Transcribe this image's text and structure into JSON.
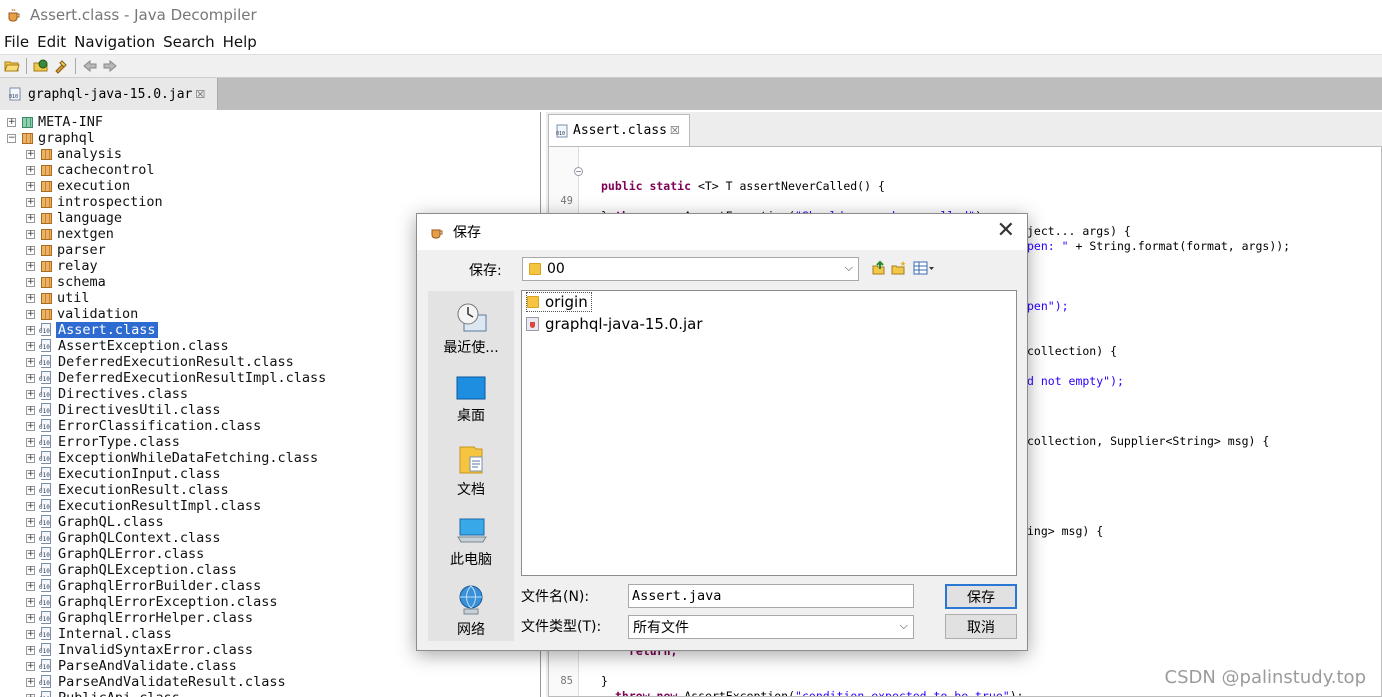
{
  "window": {
    "title": "Assert.class - Java Decompiler"
  },
  "menu": [
    "File",
    "Edit",
    "Navigation",
    "Search",
    "Help"
  ],
  "jar_tab": {
    "label": "graphql-java-15.0.jar",
    "close": "☒"
  },
  "tree": [
    {
      "label": "META-INF",
      "kind": "meta",
      "indent": 0,
      "exp": "+"
    },
    {
      "label": "graphql",
      "kind": "pkg",
      "indent": 0,
      "exp": "−"
    },
    {
      "label": "analysis",
      "kind": "pkg",
      "indent": 1,
      "exp": "+"
    },
    {
      "label": "cachecontrol",
      "kind": "pkg",
      "indent": 1,
      "exp": "+"
    },
    {
      "label": "execution",
      "kind": "pkg",
      "indent": 1,
      "exp": "+"
    },
    {
      "label": "introspection",
      "kind": "pkg",
      "indent": 1,
      "exp": "+"
    },
    {
      "label": "language",
      "kind": "pkg",
      "indent": 1,
      "exp": "+"
    },
    {
      "label": "nextgen",
      "kind": "pkg",
      "indent": 1,
      "exp": "+"
    },
    {
      "label": "parser",
      "kind": "pkg",
      "indent": 1,
      "exp": "+"
    },
    {
      "label": "relay",
      "kind": "pkg",
      "indent": 1,
      "exp": "+"
    },
    {
      "label": "schema",
      "kind": "pkg",
      "indent": 1,
      "exp": "+"
    },
    {
      "label": "util",
      "kind": "pkg",
      "indent": 1,
      "exp": "+"
    },
    {
      "label": "validation",
      "kind": "pkg",
      "indent": 1,
      "exp": "+"
    },
    {
      "label": "Assert.class",
      "kind": "cls",
      "indent": 1,
      "exp": "+",
      "selected": true
    },
    {
      "label": "AssertException.class",
      "kind": "cls",
      "indent": 1,
      "exp": "+"
    },
    {
      "label": "DeferredExecutionResult.class",
      "kind": "cls",
      "indent": 1,
      "exp": "+"
    },
    {
      "label": "DeferredExecutionResultImpl.class",
      "kind": "cls",
      "indent": 1,
      "exp": "+"
    },
    {
      "label": "Directives.class",
      "kind": "cls",
      "indent": 1,
      "exp": "+"
    },
    {
      "label": "DirectivesUtil.class",
      "kind": "cls",
      "indent": 1,
      "exp": "+"
    },
    {
      "label": "ErrorClassification.class",
      "kind": "cls",
      "indent": 1,
      "exp": "+"
    },
    {
      "label": "ErrorType.class",
      "kind": "cls",
      "indent": 1,
      "exp": "+"
    },
    {
      "label": "ExceptionWhileDataFetching.class",
      "kind": "cls",
      "indent": 1,
      "exp": "+"
    },
    {
      "label": "ExecutionInput.class",
      "kind": "cls",
      "indent": 1,
      "exp": "+"
    },
    {
      "label": "ExecutionResult.class",
      "kind": "cls",
      "indent": 1,
      "exp": "+"
    },
    {
      "label": "ExecutionResultImpl.class",
      "kind": "cls",
      "indent": 1,
      "exp": "+"
    },
    {
      "label": "GraphQL.class",
      "kind": "cls",
      "indent": 1,
      "exp": "+"
    },
    {
      "label": "GraphQLContext.class",
      "kind": "cls",
      "indent": 1,
      "exp": "+"
    },
    {
      "label": "GraphQLError.class",
      "kind": "cls",
      "indent": 1,
      "exp": "+"
    },
    {
      "label": "GraphQLException.class",
      "kind": "cls",
      "indent": 1,
      "exp": "+"
    },
    {
      "label": "GraphqlErrorBuilder.class",
      "kind": "cls",
      "indent": 1,
      "exp": "+"
    },
    {
      "label": "GraphqlErrorException.class",
      "kind": "cls",
      "indent": 1,
      "exp": "+"
    },
    {
      "label": "GraphqlErrorHelper.class",
      "kind": "cls",
      "indent": 1,
      "exp": "+"
    },
    {
      "label": "Internal.class",
      "kind": "cls",
      "indent": 1,
      "exp": "+"
    },
    {
      "label": "InvalidSyntaxError.class",
      "kind": "cls",
      "indent": 1,
      "exp": "+"
    },
    {
      "label": "ParseAndValidate.class",
      "kind": "cls",
      "indent": 1,
      "exp": "+"
    },
    {
      "label": "ParseAndValidateResult.class",
      "kind": "cls",
      "indent": 1,
      "exp": "+"
    },
    {
      "label": "PublicApi.class",
      "kind": "cls",
      "indent": 1,
      "exp": "+"
    }
  ],
  "code_tab": {
    "label": "Assert.class",
    "close": "☒"
  },
  "code": {
    "l1a": "public static",
    "l1b": " <T> T assertNeverCalled() {",
    "l2a": "throw new ",
    "l2b": "AssertException",
    "l2c": "(",
    "l2d": "\"Should never been called\"",
    "l2e": ");",
    "l3": "}",
    "frag1": "ject... args) {",
    "frag2a": "pen: \"",
    "frag2b": " + String.format(format, args));",
    "frag3": "pen\");",
    "frag4": "collection) {",
    "frag5": "d not empty\");",
    "frag6": "collection, Supplier<String> msg) {",
    "frag7": "ing> msg) {",
    "ret": "return;",
    "l85a": "throw new ",
    "l85b": "AssertException",
    "l85c": "(",
    "l85d": "\"condition expected to be true\"",
    "l85e": ");",
    "lend": "}",
    "ln49": "49",
    "ln85": "85",
    "fold": "−"
  },
  "dialog": {
    "title": "保存",
    "close": "✕",
    "save_in_label": "保存:",
    "save_in_value": "00",
    "places": [
      "最近使...",
      "桌面",
      "文档",
      "此电脑",
      "网络"
    ],
    "files": [
      "origin",
      "graphql-java-15.0.jar"
    ],
    "filename_label": "文件名(N):",
    "filename_value": "Assert.java",
    "filetype_label": "文件类型(T):",
    "filetype_value": "所有文件",
    "save_button": "保存",
    "cancel_button": "取消"
  },
  "watermark": "CSDN @palinstudy.top"
}
